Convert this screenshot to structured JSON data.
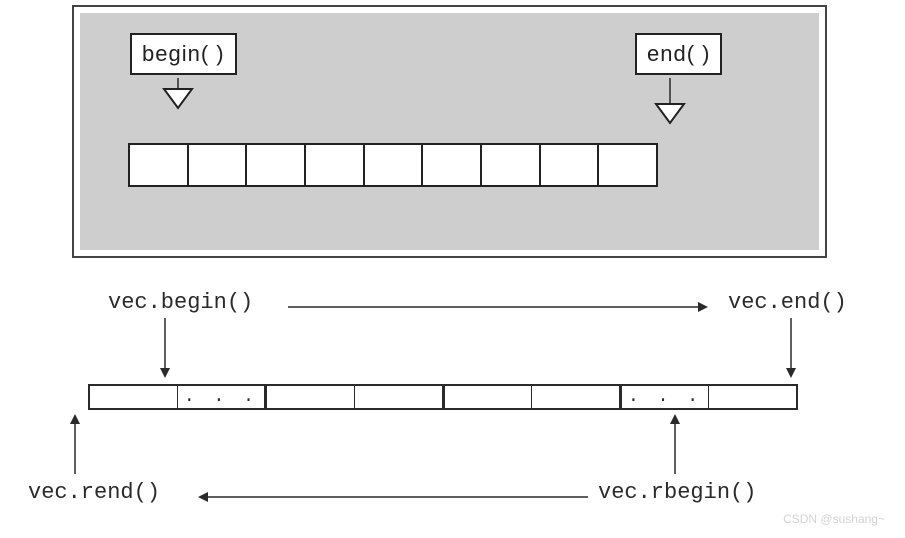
{
  "top": {
    "begin_label": "begin( )",
    "end_label": "end( )",
    "cell_count": 9
  },
  "bottom": {
    "vec_begin": "vec.begin()",
    "vec_end": "vec.end()",
    "vec_rend": "vec.rend()",
    "vec_rbegin": "vec.rbegin()",
    "cells": [
      {
        "text": "",
        "separator": "light"
      },
      {
        "text": ". . .",
        "separator": "dark"
      },
      {
        "text": "",
        "separator": "light"
      },
      {
        "text": "",
        "separator": "dark"
      },
      {
        "text": "",
        "separator": "light"
      },
      {
        "text": "",
        "separator": "dark"
      },
      {
        "text": ". . .",
        "separator": "light"
      },
      {
        "text": "",
        "separator": "none"
      }
    ]
  },
  "watermark": "CSDN @sushang~"
}
